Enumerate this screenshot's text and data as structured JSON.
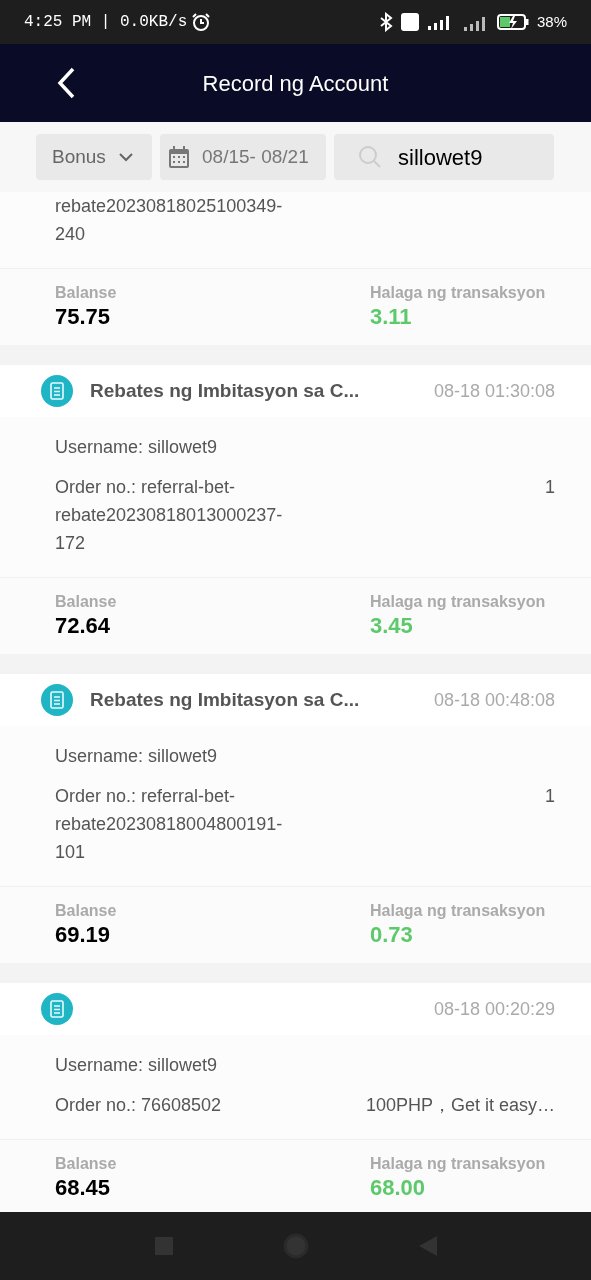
{
  "status_bar": {
    "time": "4:25 PM | 0.0KB/s",
    "battery": "38%"
  },
  "header": {
    "title": "Record ng Account"
  },
  "filters": {
    "type": "Bonus",
    "date_range": "08/15- 08/21",
    "search": "sillowet9"
  },
  "records": [
    {
      "order": "rebate20230818025100349-240",
      "balance_label": "Balanse",
      "balance": "75.75",
      "amount_label": "Halaga ng transaksyon",
      "amount": "3.11"
    },
    {
      "title": "Rebates ng Imbitasyon sa C...",
      "time": "08-18 01:30:08",
      "username": "Username: sillowet9",
      "order": "Order no.: referral-bet-rebate20230818013000237-172",
      "note": "1",
      "balance_label": "Balanse",
      "balance": "72.64",
      "amount_label": "Halaga ng transaksyon",
      "amount": "3.45"
    },
    {
      "title": "Rebates ng Imbitasyon sa C...",
      "time": "08-18 00:48:08",
      "username": "Username: sillowet9",
      "order": "Order no.: referral-bet-rebate20230818004800191-101",
      "note": "1",
      "balance_label": "Balanse",
      "balance": "69.19",
      "amount_label": "Halaga ng transaksyon",
      "amount": "0.73"
    },
    {
      "time": "08-18 00:20:29",
      "username": "Username: sillowet9",
      "order": "Order no.: 76608502",
      "note": "100PHP，Get it easy…",
      "balance_label": "Balanse",
      "balance": "68.45",
      "amount_label": "Halaga ng transaksyon",
      "amount": "68.00"
    }
  ]
}
